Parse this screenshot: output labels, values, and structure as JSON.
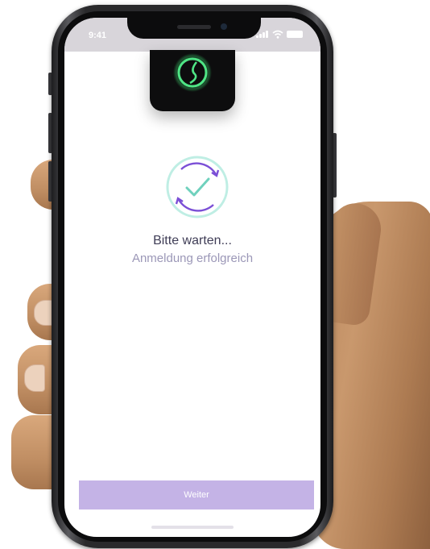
{
  "status_bar": {
    "time": "9:41",
    "icons": [
      "signal-icon",
      "wifi-icon",
      "battery-icon"
    ]
  },
  "app_logo": {
    "icon": "app-logo-icon",
    "colors": {
      "background": "#0d0d0e",
      "glow": "#3ddc72"
    }
  },
  "main": {
    "status_icon": "sync-check-icon",
    "title": "Bitte warten...",
    "subtitle": "Anmeldung erfolgreich"
  },
  "footer": {
    "continue_label": "Weiter"
  },
  "colors": {
    "accent": "#c4b3e6",
    "icon_purple": "#7b4fd6",
    "icon_teal": "#6fd1bd",
    "title": "#3f3d56",
    "subtitle": "#9b97b7",
    "status_bar": "#d8d5da"
  }
}
